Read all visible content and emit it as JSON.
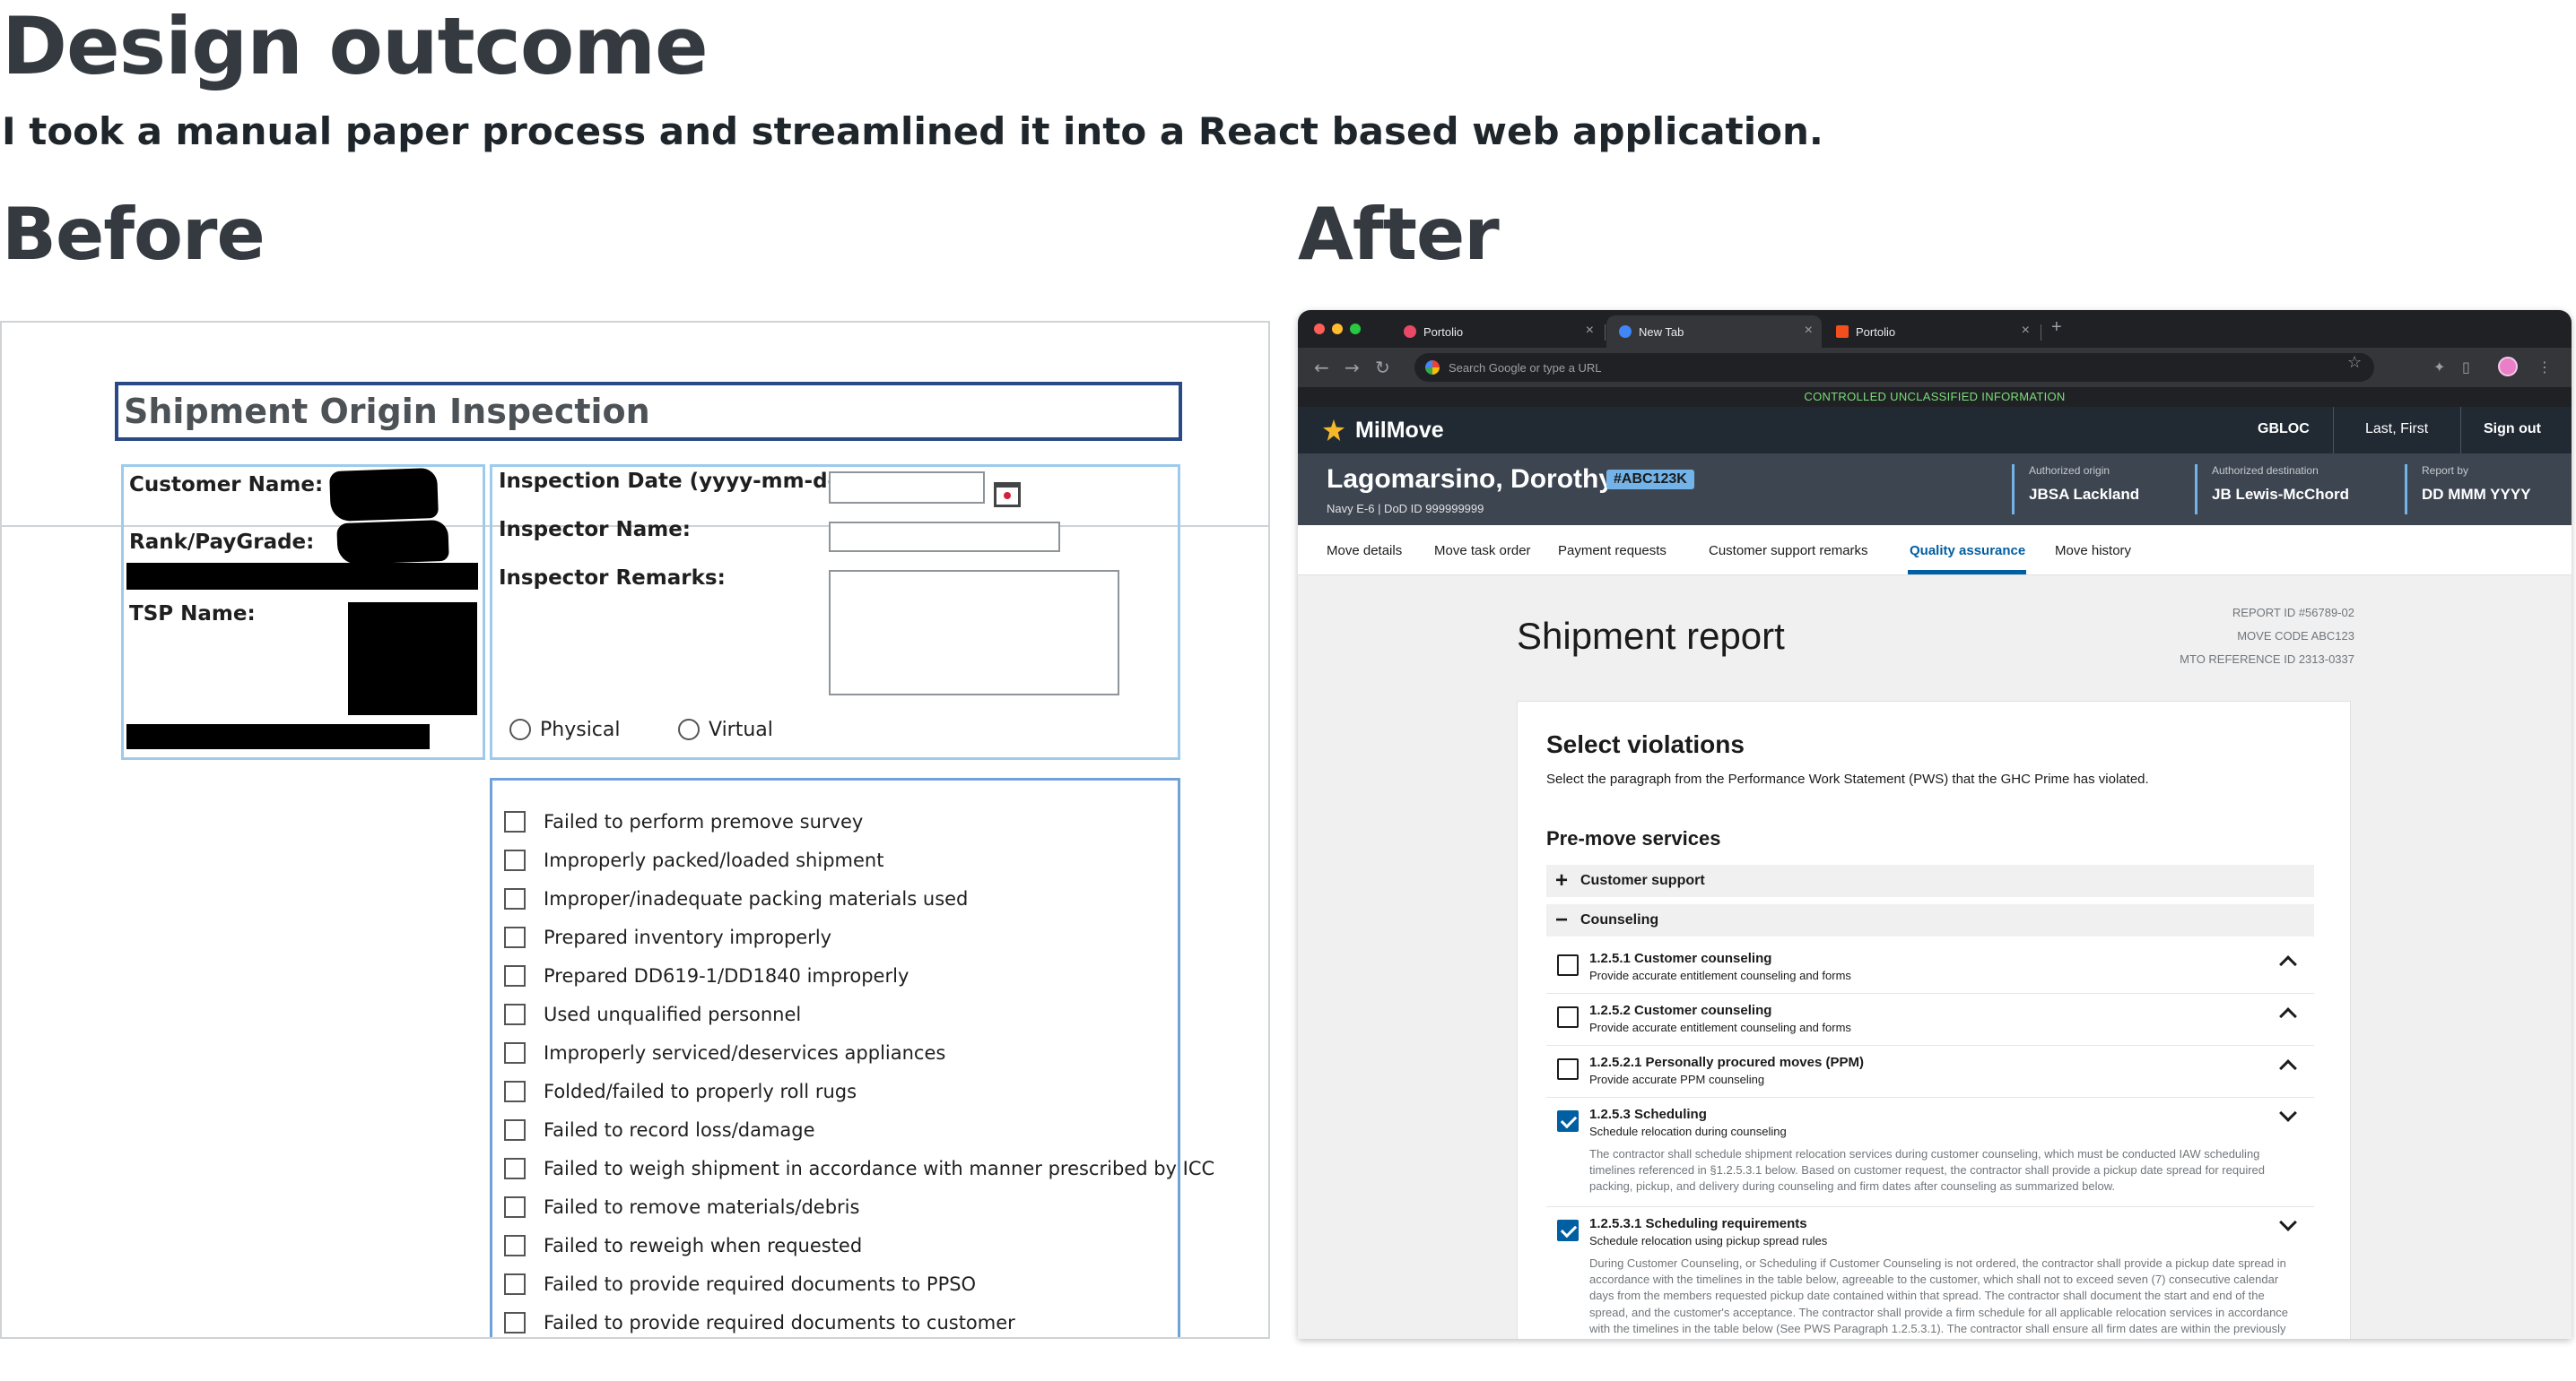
{
  "page": {
    "title": "Design outcome",
    "lead": "I took a manual paper process and streamlined it into a React based web application.",
    "before_label": "Before",
    "after_label": "After"
  },
  "paper_form": {
    "title": "Shipment Origin Inspection",
    "labels": {
      "customer_name": "Customer Name:",
      "rank": "Rank/PayGrade:",
      "tsp": "TSP Name:",
      "inspection_date": "Inspection Date (yyyy-mm-dd):",
      "inspector_name": "Inspector Name:",
      "inspector_remarks": "Inspector Remarks:"
    },
    "radios": [
      "Physical",
      "Virtual"
    ],
    "checklist": [
      "Failed to perform premove survey",
      "Improperly packed/loaded shipment",
      "Improper/inadequate packing materials used",
      "Prepared inventory improperly",
      "Prepared DD619-1/DD1840 improperly",
      "Used unqualified personnel",
      "Improperly serviced/deservices appliances",
      "Folded/failed to properly roll rugs",
      "Failed to record loss/damage",
      "Failed to weigh shipment in accordance with manner prescribed by ICC",
      "Failed to remove materials/debris",
      "Failed to reweigh when requested",
      "Failed to provide required documents to PPSO",
      "Failed to provide required documents to customer"
    ]
  },
  "browser": {
    "tabs": [
      {
        "label": "Portolio",
        "active": false,
        "fav_color": "#e84a66"
      },
      {
        "label": "New Tab",
        "active": true,
        "fav_color": "#4285f4"
      },
      {
        "label": "Portolio",
        "active": false,
        "fav_color": "#f24e1e"
      }
    ],
    "omnibox_placeholder": "Search Google or type a URL"
  },
  "app": {
    "banner": "CONTROLLED UNCLASSIFIED INFORMATION",
    "brand": "MilMove",
    "nav": {
      "gbloc": "GBLOC",
      "user": "Last, First",
      "signout": "Sign out"
    },
    "customer": {
      "name": "Lagomarsino, Dorothy",
      "locator": "#ABC123K",
      "sub": "Navy E-6  |  DoD ID 999999999",
      "info": [
        {
          "label": "Authorized origin",
          "value": "JBSA Lackland"
        },
        {
          "label": "Authorized destination",
          "value": "JB Lewis-McChord"
        },
        {
          "label": "Report by",
          "value": "DD MMM YYYY"
        }
      ]
    },
    "subnav": [
      "Move details",
      "Move task order",
      "Payment requests",
      "Customer support remarks",
      "Quality assurance",
      "Move history"
    ],
    "subnav_active": "Quality assurance",
    "report": {
      "title": "Shipment report",
      "meta": [
        "REPORT ID #56789-02",
        "MOVE CODE ABC123",
        "MTO REFERENCE ID 2313-0337"
      ]
    },
    "violations": {
      "title": "Select violations",
      "description": "Select the paragraph from the Performance Work Statement (PWS) that the GHC Prime has violated.",
      "section": "Pre-move services",
      "accordions": [
        {
          "sign": "+",
          "label": "Customer support"
        },
        {
          "sign": "−",
          "label": "Counseling"
        }
      ],
      "items": [
        {
          "title": "1.2.5.1 Customer counseling",
          "sub": "Provide accurate entitlement counseling and forms",
          "checked": false,
          "expanded": false,
          "detail": ""
        },
        {
          "title": "1.2.5.2 Customer counseling",
          "sub": "Provide accurate entitlement counseling and forms",
          "checked": false,
          "expanded": false,
          "detail": ""
        },
        {
          "title": "1.2.5.2.1 Personally procured moves (PPM)",
          "sub": "Provide accurate PPM counseling",
          "checked": false,
          "expanded": false,
          "detail": ""
        },
        {
          "title": "1.2.5.3 Scheduling",
          "sub": "Schedule relocation during counseling",
          "checked": true,
          "expanded": true,
          "detail": "The contractor shall schedule shipment relocation services during customer counseling, which must be conducted IAW scheduling timelines referenced in §1.2.5.3.1 below.  Based on customer request, the contractor shall provide a pickup date spread for required packing, pickup, and delivery during counseling and firm dates after counseling as summarized below."
        },
        {
          "title": "1.2.5.3.1 Scheduling requirements",
          "sub": "Schedule relocation using pickup spread rules",
          "checked": true,
          "expanded": true,
          "detail": "During Customer Counseling, or Scheduling if Customer Counseling is not ordered, the contractor shall provide a pickup date spread in accordance with the timelines in the table below, agreeable to the customer, which shall not to exceed seven (7) consecutive calendar days from the members requested pickup date contained within that spread. The contractor shall document the start and end of the spread, and the customer's acceptance. The contractor shall provide a firm schedule for all applicable relocation services in accordance with the timelines in the table below (See PWS Paragraph 1.2.5.3.1). The contractor shall ensure all firm dates are within the previously agreed upon spread. An \"approved order\" is an order sent to the contractor after the Ordering Officer (OO) validates the requirement."
        }
      ]
    }
  }
}
